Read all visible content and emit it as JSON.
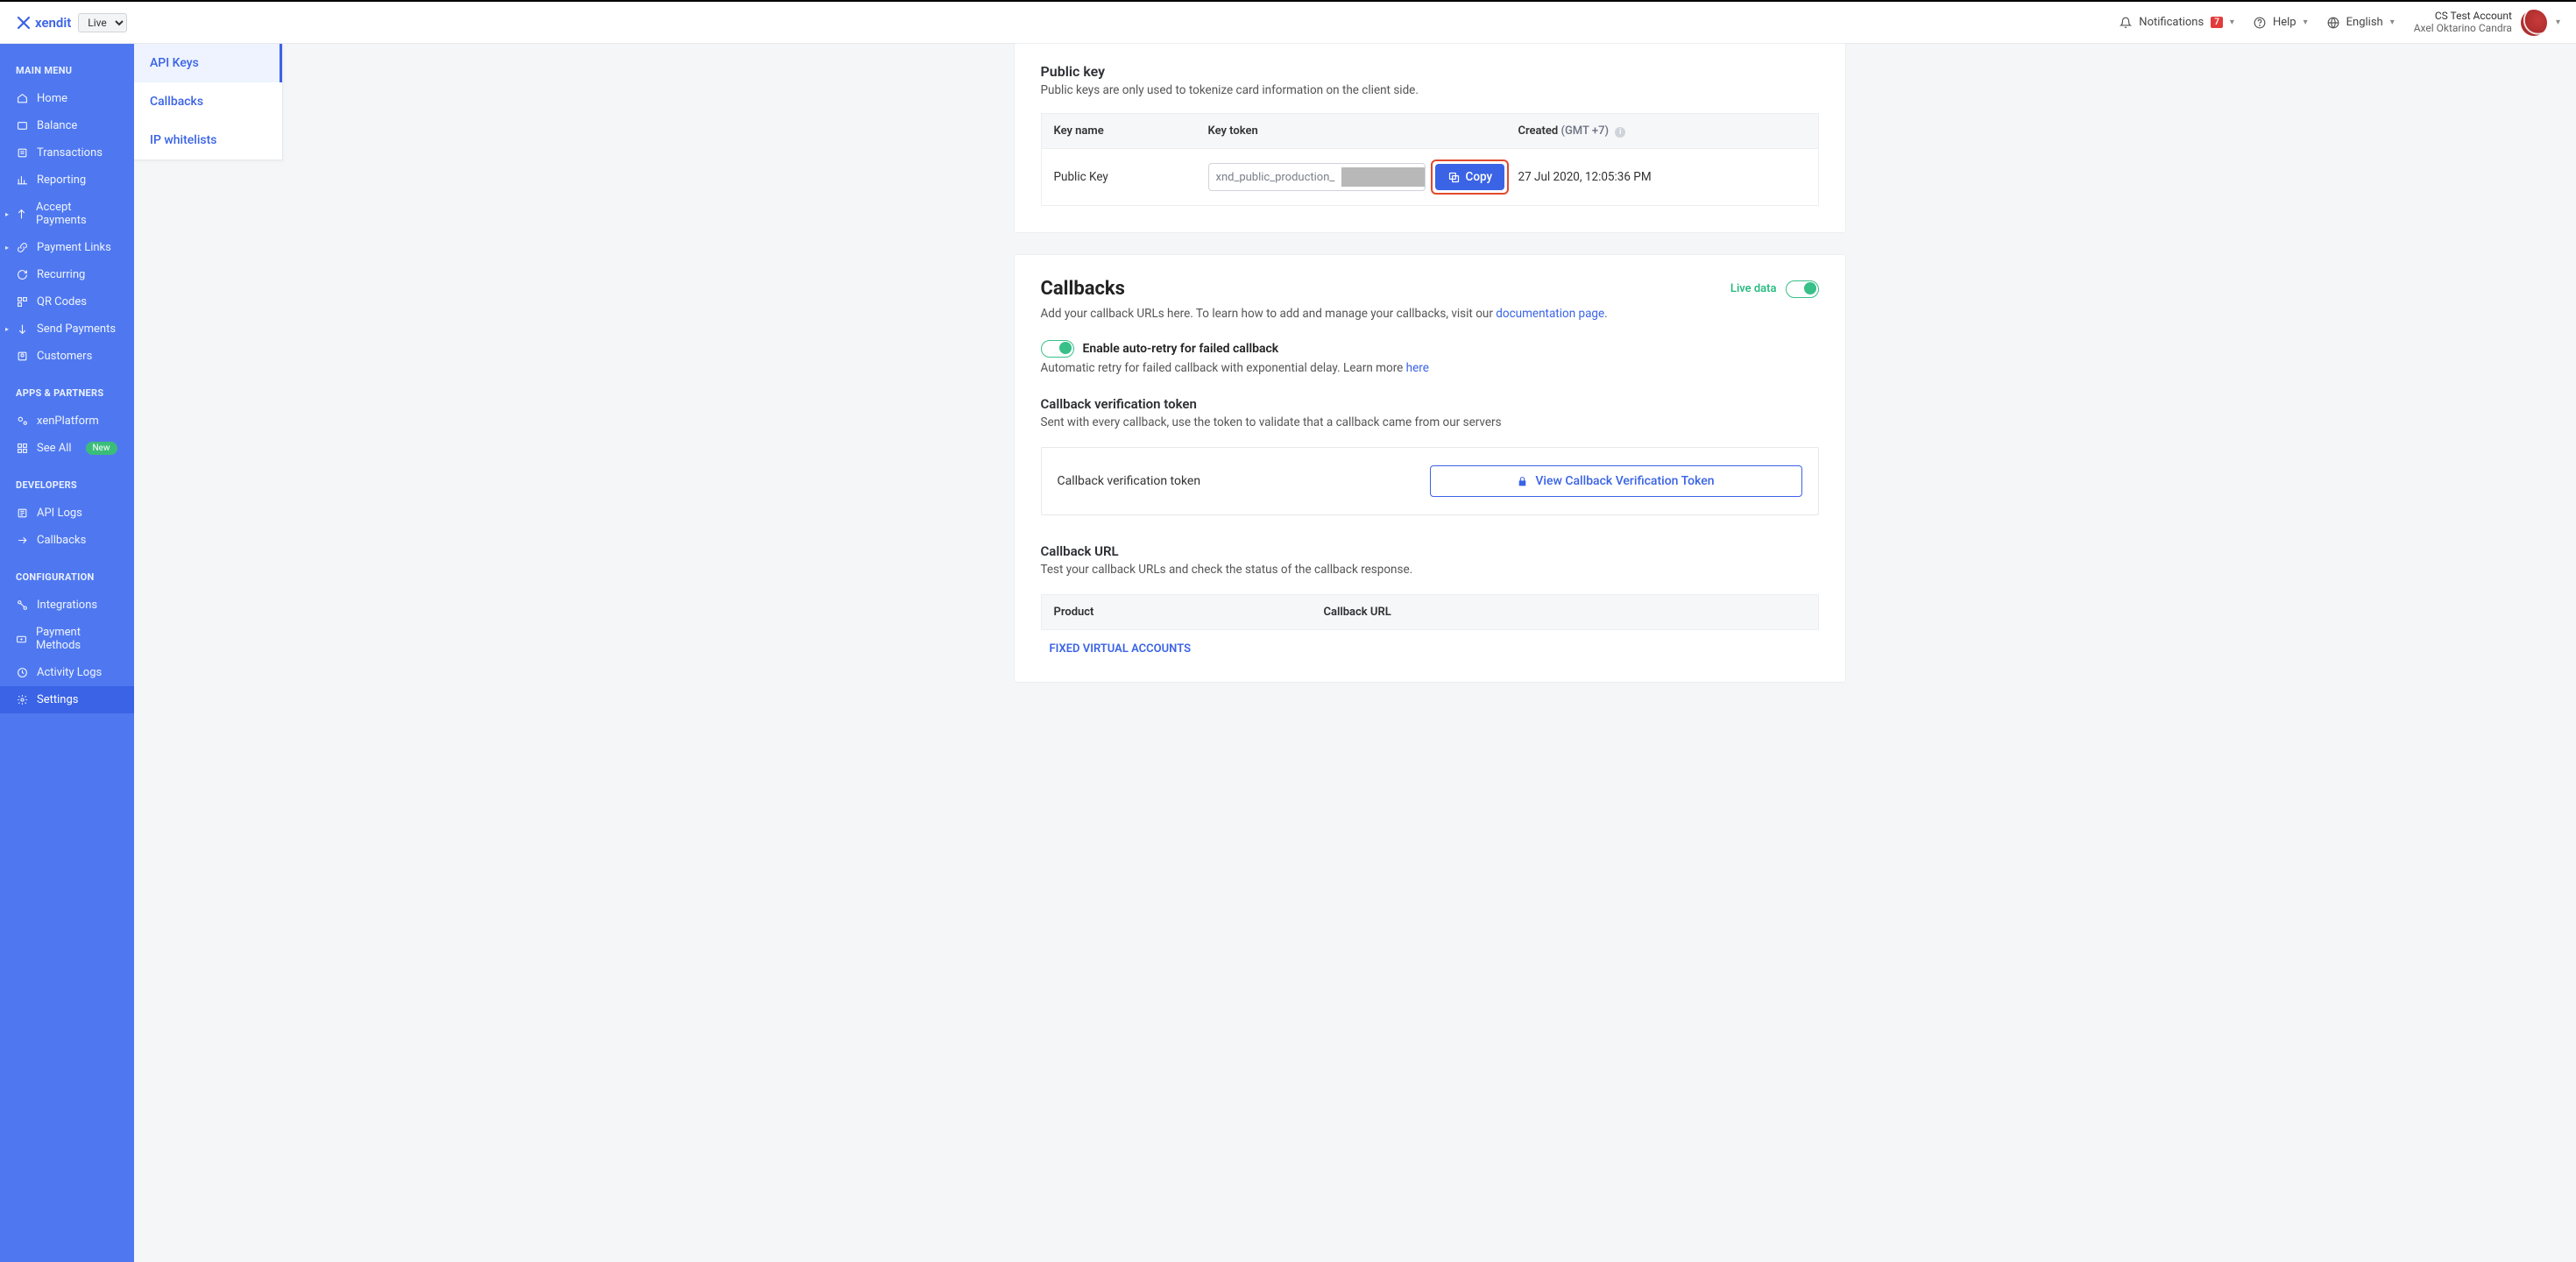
{
  "header": {
    "brand": "xendit",
    "env": "Live",
    "notifications_label": "Notifications",
    "notifications_badge": "7",
    "help_label": "Help",
    "language_label": "English",
    "account_name": "CS Test Account",
    "account_user": "Axel Oktarino Candra"
  },
  "sidebar": {
    "sections": [
      {
        "heading": "MAIN MENU",
        "items": [
          {
            "label": "Home",
            "icon": "home-icon"
          },
          {
            "label": "Balance",
            "icon": "balance-icon"
          },
          {
            "label": "Transactions",
            "icon": "transactions-icon"
          },
          {
            "label": "Reporting",
            "icon": "reporting-icon"
          },
          {
            "label": "Accept Payments",
            "icon": "accept-payments-icon",
            "expandable": true
          },
          {
            "label": "Payment Links",
            "icon": "payment-links-icon",
            "expandable": true
          },
          {
            "label": "Recurring",
            "icon": "recurring-icon"
          },
          {
            "label": "QR Codes",
            "icon": "qr-codes-icon"
          },
          {
            "label": "Send Payments",
            "icon": "send-payments-icon",
            "expandable": true
          },
          {
            "label": "Customers",
            "icon": "customers-icon"
          }
        ]
      },
      {
        "heading": "APPS & PARTNERS",
        "items": [
          {
            "label": "xenPlatform",
            "icon": "xenplatform-icon"
          },
          {
            "label": "See All",
            "icon": "see-all-icon",
            "badge": "New"
          }
        ]
      },
      {
        "heading": "DEVELOPERS",
        "items": [
          {
            "label": "API Logs",
            "icon": "api-logs-icon"
          },
          {
            "label": "Callbacks",
            "icon": "callbacks-icon"
          }
        ]
      },
      {
        "heading": "CONFIGURATION",
        "items": [
          {
            "label": "Integrations",
            "icon": "integrations-icon"
          },
          {
            "label": "Payment Methods",
            "icon": "payment-methods-icon"
          },
          {
            "label": "Activity Logs",
            "icon": "activity-logs-icon"
          },
          {
            "label": "Settings",
            "icon": "settings-icon",
            "active": true
          }
        ]
      }
    ]
  },
  "submenu": {
    "items": [
      {
        "label": "API Keys",
        "active": true
      },
      {
        "label": "Callbacks"
      },
      {
        "label": "IP whitelists"
      }
    ]
  },
  "public_key": {
    "title": "Public key",
    "desc": "Public keys are only used to tokenize card information on the client side.",
    "col_name": "Key name",
    "col_token": "Key token",
    "col_created": "Created",
    "col_created_tz": "(GMT +7)",
    "row_name": "Public Key",
    "row_token_prefix": "xnd_public_production_",
    "copy_label": "Copy",
    "row_created": "27 Jul 2020, 12:05:36 PM"
  },
  "callbacks": {
    "title": "Callbacks",
    "live_data_label": "Live data",
    "desc_pre": "Add your callback URLs here. To learn how to add and manage your callbacks, visit our ",
    "desc_link": "documentation page",
    "desc_post": ".",
    "retry_label": "Enable auto-retry for failed callback",
    "retry_desc_pre": "Automatic retry for failed callback with exponential delay. Learn more ",
    "retry_desc_link": "here",
    "verify_title": "Callback verification token",
    "verify_desc": "Sent with every callback, use the token to validate that a callback came from our servers",
    "verify_box_label": "Callback verification token",
    "verify_button": "View Callback Verification Token",
    "url_title": "Callback URL",
    "url_desc": "Test your callback URLs and check the status of the callback response.",
    "url_col_product": "Product",
    "url_col_url": "Callback URL",
    "url_group1": "FIXED VIRTUAL ACCOUNTS"
  }
}
